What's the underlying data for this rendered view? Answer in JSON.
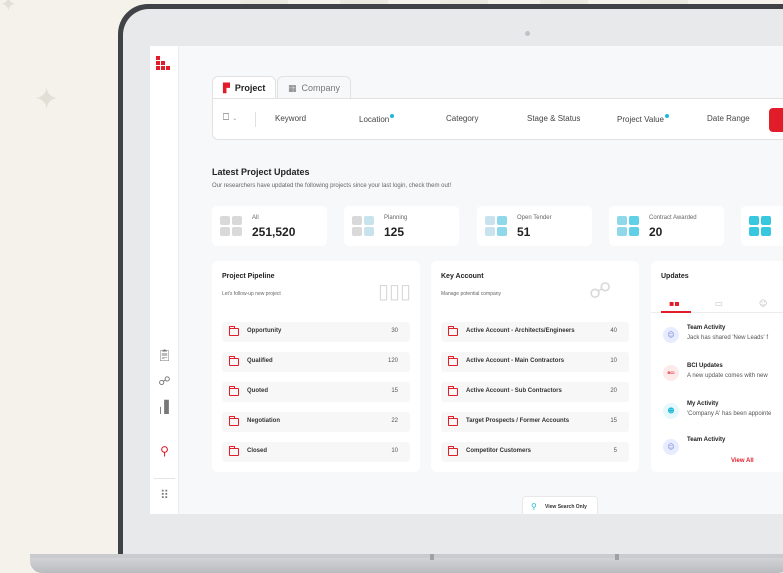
{
  "tabs": [
    {
      "label": "Project",
      "icon": "project-icon"
    },
    {
      "label": "Company",
      "icon": "building-icon"
    }
  ],
  "filters": {
    "bookmark_icon": "bookmark-icon",
    "keyword": "Keyword",
    "location": "Location",
    "category": "Category",
    "stage_status": "Stage & Status",
    "project_value": "Project Value",
    "date_range": "Date Range"
  },
  "updates_section": {
    "title": "Latest Project Updates",
    "subtitle": "Our researchers have updated the following projects since your last login, check them out!"
  },
  "stats": [
    {
      "label": "All",
      "value": "251,520",
      "color": "#d9d9d9"
    },
    {
      "label": "Planning",
      "value": "125",
      "color": "#c9e3ee"
    },
    {
      "label": "Open Tender",
      "value": "51",
      "color": "#8fd8ea"
    },
    {
      "label": "Contract Awarded",
      "value": "20",
      "color": "#5fd0e6"
    },
    {
      "label": "",
      "value": "",
      "color": "#37c8e0"
    }
  ],
  "pipeline": {
    "title": "Project Pipeline",
    "subtitle": "Let's follow-up new project",
    "rows": [
      {
        "label": "Opportunity",
        "value": "30"
      },
      {
        "label": "Qualified",
        "value": "120"
      },
      {
        "label": "Quoted",
        "value": "15"
      },
      {
        "label": "Negotiation",
        "value": "22"
      },
      {
        "label": "Closed",
        "value": "10"
      }
    ]
  },
  "key_account": {
    "title": "Key Account",
    "subtitle": "Manage potential company",
    "rows": [
      {
        "label": "Active Account - Architects/Engineers",
        "value": "40"
      },
      {
        "label": "Active Account - Main Contractors",
        "value": "10"
      },
      {
        "label": "Active Account - Sub Contractors",
        "value": "20"
      },
      {
        "label": "Target Prospects / Former Accounts",
        "value": "15"
      },
      {
        "label": "Competitor Customers",
        "value": "5"
      }
    ]
  },
  "updates": {
    "title": "Updates",
    "items": [
      {
        "title": "Team Activity",
        "desc": "Jack has shared 'New Leads' f",
        "icon": "team-icon"
      },
      {
        "title": "BCI Updates",
        "desc": "A new update comes with new",
        "icon": "bci-icon",
        "badge": "BCI"
      },
      {
        "title": "My Activity",
        "desc": "'Company A' has been appointe",
        "icon": "user-icon"
      },
      {
        "title": "Team Activity",
        "desc": "",
        "icon": "team-icon"
      }
    ],
    "view_all": "View All"
  },
  "view_search_only": "View Search Only",
  "colors": {
    "brand": "#e11d2a",
    "accent": "#1fb8d6"
  }
}
